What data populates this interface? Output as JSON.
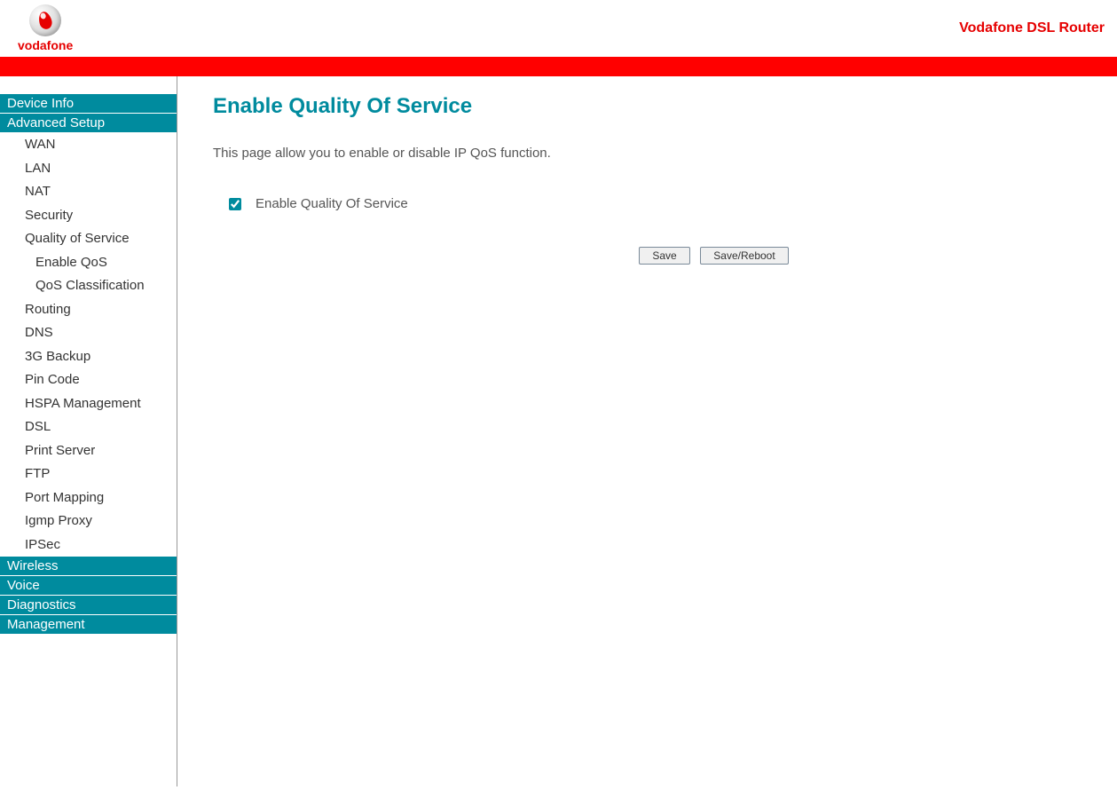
{
  "header": {
    "logo_text": "vodafone",
    "title": "Vodafone DSL Router"
  },
  "sidebar": {
    "sections": [
      {
        "label": "Device Info",
        "type": "section"
      },
      {
        "label": "Advanced Setup",
        "type": "section"
      },
      {
        "label": "WAN",
        "type": "item"
      },
      {
        "label": "LAN",
        "type": "item"
      },
      {
        "label": "NAT",
        "type": "item"
      },
      {
        "label": "Security",
        "type": "item"
      },
      {
        "label": "Quality of Service",
        "type": "item"
      },
      {
        "label": "Enable QoS",
        "type": "subitem"
      },
      {
        "label": "QoS Classification",
        "type": "subitem"
      },
      {
        "label": "Routing",
        "type": "item"
      },
      {
        "label": "DNS",
        "type": "item"
      },
      {
        "label": "3G Backup",
        "type": "item"
      },
      {
        "label": "Pin Code",
        "type": "item"
      },
      {
        "label": "HSPA Management",
        "type": "item"
      },
      {
        "label": "DSL",
        "type": "item"
      },
      {
        "label": "Print Server",
        "type": "item"
      },
      {
        "label": "FTP",
        "type": "item"
      },
      {
        "label": "Port Mapping",
        "type": "item"
      },
      {
        "label": "Igmp Proxy",
        "type": "item"
      },
      {
        "label": "IPSec",
        "type": "item"
      },
      {
        "label": "Wireless",
        "type": "section"
      },
      {
        "label": "Voice",
        "type": "section"
      },
      {
        "label": "Diagnostics",
        "type": "section"
      },
      {
        "label": "Management",
        "type": "section"
      }
    ]
  },
  "content": {
    "heading": "Enable Quality Of Service",
    "description": "This page allow you to enable or disable IP QoS function.",
    "checkbox_label": "Enable Quality Of Service",
    "checkbox_checked": true,
    "buttons": {
      "save": "Save",
      "save_reboot": "Save/Reboot"
    }
  }
}
